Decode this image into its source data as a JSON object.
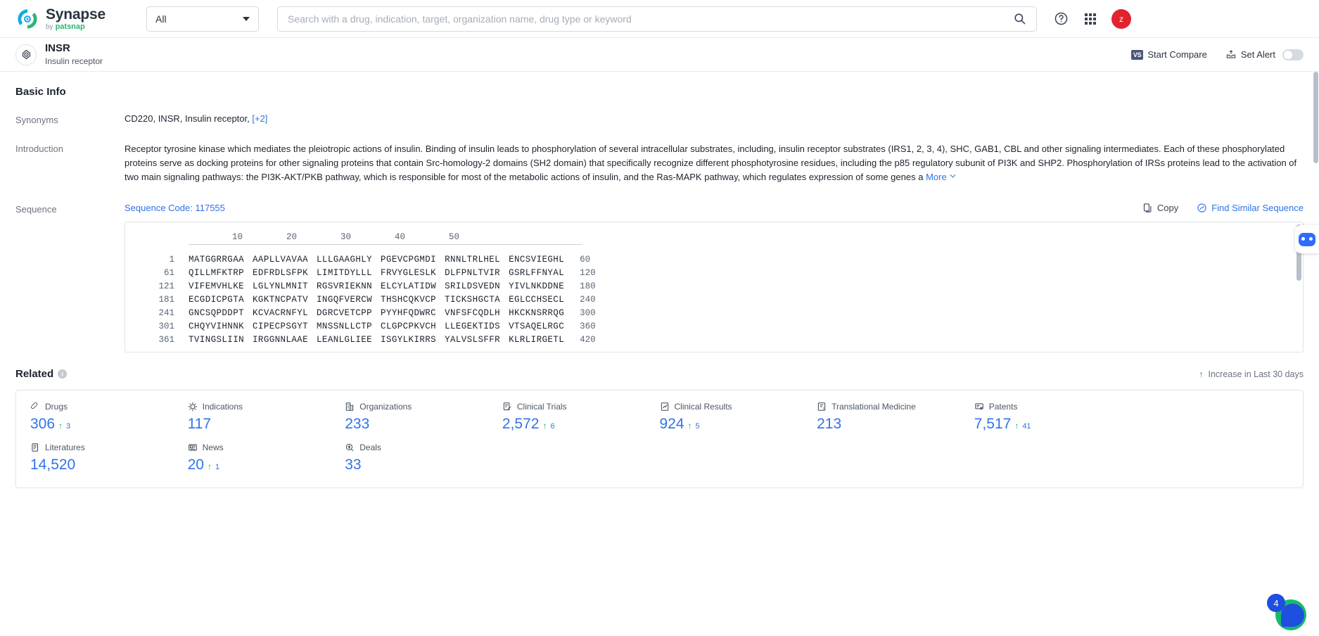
{
  "topbar": {
    "logo_title": "Synapse",
    "logo_sub_by": "by",
    "logo_sub_brand": "patsnap",
    "scope_select": "All",
    "search_placeholder": "Search with a drug, indication, target, organization name, drug type or keyword",
    "icons": {
      "search": "search-icon",
      "help": "help-icon",
      "apps": "grid-icon"
    },
    "avatar_initial": "z"
  },
  "subheader": {
    "title": "INSR",
    "subtitle": "Insulin receptor",
    "start_compare": "Start Compare",
    "vs_badge": "VS",
    "set_alert": "Set Alert"
  },
  "basic_info": {
    "section_title": "Basic Info",
    "synonyms_label": "Synonyms",
    "synonyms_value": "CD220,  INSR,  Insulin receptor,",
    "synonyms_more": "[+2]",
    "introduction_label": "Introduction",
    "introduction_text": "Receptor tyrosine kinase which mediates the pleiotropic actions of insulin. Binding of insulin leads to phosphorylation of several intracellular substrates, including, insulin receptor substrates (IRS1, 2, 3, 4), SHC, GAB1, CBL and other signaling intermediates. Each of these phosphorylated proteins serve as docking proteins for other signaling proteins that contain Src-homology-2 domains (SH2 domain) that specifically recognize different phosphotyrosine residues, including the p85 regulatory subunit of PI3K and SHP2. Phosphorylation of IRSs proteins lead to the activation of two main signaling pathways: the PI3K-AKT/PKB pathway, which is responsible for most of the metabolic actions of insulin, and the Ras-MAPK pathway, which regulates expression of some genes a",
    "introduction_more": "More"
  },
  "sequence": {
    "label": "Sequence",
    "code_text": "Sequence Code: 117555",
    "copy_label": "Copy",
    "find_similar_label": "Find Similar Sequence",
    "ruler": [
      "10",
      "20",
      "30",
      "40",
      "50"
    ],
    "lines": [
      {
        "start": "1",
        "blocks": [
          "MATGGRRGAA",
          "AAPLLVAVAA",
          "LLLGAAGHLY",
          "PGEVCPGMDI",
          "RNNLTRLHEL",
          "ENCSVIEGHL"
        ],
        "end": "60"
      },
      {
        "start": "61",
        "blocks": [
          "QILLMFKTRP",
          "EDFRDLSFPK",
          "LIMITDYLLL",
          "FRVYGLESLK",
          "DLFPNLTVIR",
          "GSRLFFNYAL"
        ],
        "end": "120"
      },
      {
        "start": "121",
        "blocks": [
          "VIFEMVHLKE",
          "LGLYNLMNIT",
          "RGSVRIEKNN",
          "ELCYLATIDW",
          "SRILDSVEDN",
          "YIVLNKDDNE"
        ],
        "end": "180"
      },
      {
        "start": "181",
        "blocks": [
          "ECGDICPGTA",
          "KGKTNCPATV",
          "INGQFVERCW",
          "THSHCQKVCP",
          "TICKSHGCTA",
          "EGLCCHSECL"
        ],
        "end": "240"
      },
      {
        "start": "241",
        "blocks": [
          "GNCSQPDDPT",
          "KCVACRNFYL",
          "DGRCVETCPP",
          "PYYHFQDWRC",
          "VNFSFCQDLH",
          "HKCKNSRRQG"
        ],
        "end": "300"
      },
      {
        "start": "301",
        "blocks": [
          "CHQYVIHNNK",
          "CIPECPSGYT",
          "MNSSNLLCTP",
          "CLGPCPKVCH",
          "LLEGEKTIDS",
          "VTSAQELRGC"
        ],
        "end": "360"
      },
      {
        "start": "361",
        "blocks": [
          "TVINGSLIIN",
          "IRGGNNLAAE",
          "LEANLGLIEE",
          "ISGYLKIRRS",
          "YALVSLSFFR",
          "KLRLIRGETL"
        ],
        "end": "420"
      }
    ]
  },
  "related": {
    "title": "Related",
    "legend": "Increase in Last 30 days",
    "legend_arrow": "↑",
    "stats": [
      {
        "icon": "pill-icon",
        "label": "Drugs",
        "value": "306",
        "delta": "3"
      },
      {
        "icon": "virus-icon",
        "label": "Indications",
        "value": "117",
        "delta": ""
      },
      {
        "icon": "building-icon",
        "label": "Organizations",
        "value": "233",
        "delta": ""
      },
      {
        "icon": "trial-icon",
        "label": "Clinical Trials",
        "value": "2,572",
        "delta": "6"
      },
      {
        "icon": "results-icon",
        "label": "Clinical Results",
        "value": "924",
        "delta": "5"
      },
      {
        "icon": "medicine-icon",
        "label": "Translational Medicine",
        "value": "213",
        "delta": ""
      },
      {
        "icon": "patent-icon",
        "label": "Patents",
        "value": "7,517",
        "delta": "41"
      },
      {
        "icon": "",
        "label": "",
        "value": "",
        "delta": ""
      },
      {
        "icon": "literature-icon",
        "label": "Literatures",
        "value": "14,520",
        "delta": ""
      },
      {
        "icon": "news-icon",
        "label": "News",
        "value": "20",
        "delta": "1"
      },
      {
        "icon": "deals-icon",
        "label": "Deals",
        "value": "33",
        "delta": ""
      }
    ]
  },
  "floating": {
    "badge_count": "4",
    "bot_icon": "chat-bot-icon"
  },
  "colors": {
    "accent_blue": "#2f73e8",
    "up_green": "#21a366",
    "avatar_red": "#e0232e"
  }
}
